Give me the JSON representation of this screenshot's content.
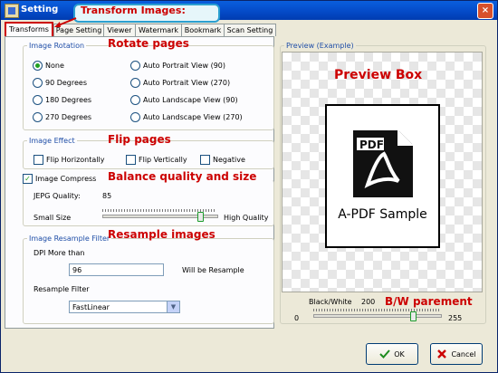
{
  "window": {
    "title": "Setting",
    "close_label": "×"
  },
  "tabs": [
    "Transforms",
    "Page Setting",
    "Viewer",
    "Watermark",
    "Bookmark",
    "Scan Setting"
  ],
  "active_tab": "Transforms",
  "annotations": {
    "transform": "Transform Images:",
    "rotate": "Rotate pages",
    "flip": "Flip pages",
    "quality": "Balance quality and size",
    "resample": "Resample images",
    "preview": "Preview Box",
    "bw": "B/W parement"
  },
  "rotation": {
    "legend": "Image Rotation",
    "options": [
      "None",
      "90 Degrees",
      "180 Degrees",
      "270 Degrees",
      "Auto Portrait View (90)",
      "Auto Portrait View (270)",
      "Auto Landscape View (90)",
      "Auto Landscape View (270)"
    ],
    "selected": "None"
  },
  "effect": {
    "legend": "Image Effect",
    "flip_h": "Flip Horizontally",
    "flip_v": "Flip Vertically",
    "negative": "Negative"
  },
  "compress": {
    "label": "Image Compress",
    "checked": true,
    "jpeg_label": "JEPG Quality:",
    "jpeg_value": "85",
    "quality_level": 0.85,
    "small": "Small Size",
    "high": "High Quality"
  },
  "resample": {
    "legend": "Image Resample Filter",
    "dpi_label": "DPI More than",
    "dpi_value": "96",
    "will_be": "Will be Resample",
    "filter_label": "Resample Filter",
    "filter_value": "FastLinear"
  },
  "preview": {
    "legend": "Preview (Example)",
    "sample_text": "A-PDF Sample",
    "bw_label": "Black/White",
    "bw_value": "200",
    "bw_min": "0",
    "bw_max": "255",
    "bw_level": 200
  },
  "buttons": {
    "ok": "OK",
    "cancel": "Cancel"
  },
  "colors": {
    "annotation": "#cc0000",
    "legend": "#1f4ea7",
    "title_bar": "#0449c6"
  }
}
